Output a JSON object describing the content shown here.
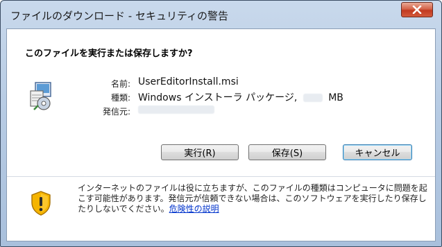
{
  "window": {
    "title": "ファイルのダウンロード - セキュリティの警告",
    "close_label": "X"
  },
  "dialog": {
    "question": "このファイルを実行または保存しますか?",
    "fields": {
      "name_label": "名前:",
      "name_value": "UserEditorInstall.msi",
      "type_label": "種類:",
      "type_value": "Windows インストーラ パッケージ,",
      "size_unit": "MB",
      "from_label": "発信元:"
    },
    "buttons": {
      "run": "実行(R)",
      "save": "保存(S)",
      "cancel": "キャンセル"
    },
    "warning": {
      "text": "インターネットのファイルは役に立ちますが、このファイルの種類はコンピュータに問題を起こす可能性があります。発信元が信頼できない場合は、このソフトウェアを実行したり保存したりしないでください。",
      "link": "危険性の説明"
    }
  },
  "colors": {
    "link": "#0033cc",
    "close_button": "#c13a20",
    "shield": "#f5b400"
  },
  "icons": {
    "file": "installer-package-icon",
    "warning": "shield-warning-icon",
    "close": "close-x-icon"
  }
}
